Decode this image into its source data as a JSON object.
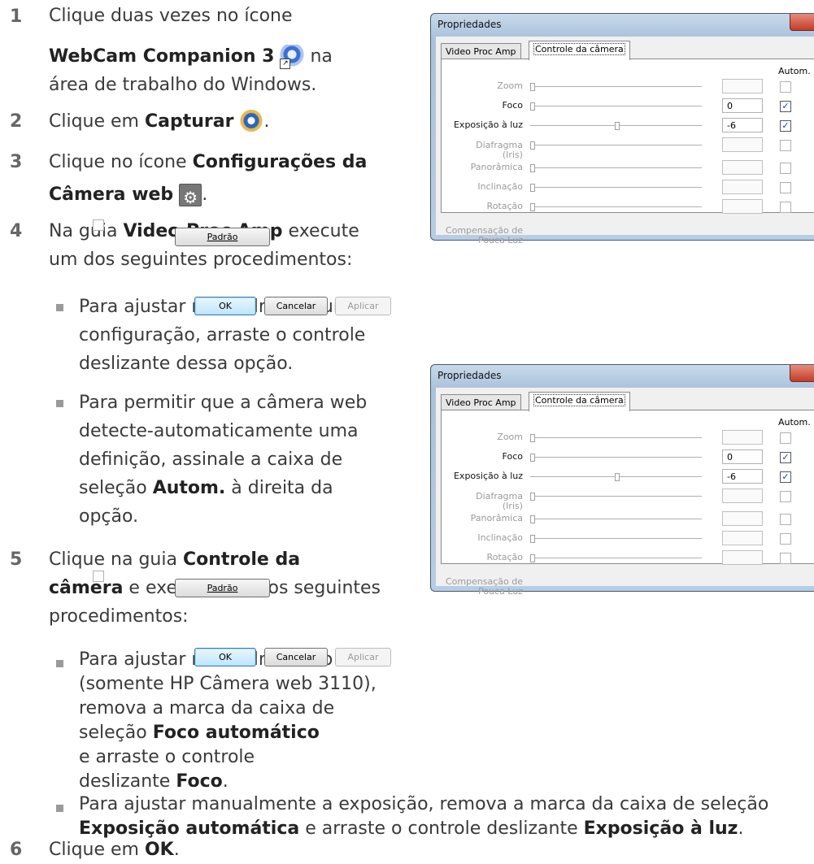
{
  "steps": [
    {
      "num": "1",
      "lines": [
        "Clique duas vezes no ícone"
      ],
      "bold": "WebCam Companion 3",
      "after_icon": "na",
      "line3": "área de trabalho do Windows."
    },
    {
      "num": "2",
      "pre": "Clique em ",
      "bold": "Capturar",
      "post": "."
    },
    {
      "num": "3",
      "pre": "Clique no ícone ",
      "bold1": "Configurações da",
      "bold2": "Câmera web",
      "post": "."
    },
    {
      "num": "4",
      "pre": "Na guia ",
      "bold": "Video Proc Amp",
      "post": " execute",
      "line2": "um dos seguintes procedimentos:"
    },
    {
      "num": "5",
      "pre": "Clique na guia ",
      "bold1": "Controle da",
      "bold2": "câmera",
      "post": " e execute um dos seguintes",
      "line3": "procedimentos:"
    },
    {
      "num": "6",
      "pre": "Clique em ",
      "bold": "OK",
      "post": "."
    }
  ],
  "bullets4": {
    "b1": [
      "Para ajustar manualmente uma",
      "configuração, arraste o controle",
      "deslizante dessa opção."
    ],
    "b2": [
      "Para permitir que a câmera web",
      "detecte-automaticamente uma",
      "definição, assinale a caixa de"
    ],
    "b2_l4_pre": "seleção ",
    "b2_l4_bold": "Autom.",
    "b2_l4_post": " à direita da",
    "b2_l5": "opção."
  },
  "bullets5": {
    "b1": [
      "Para ajustar manualmente o foco",
      "(somente HP Câmera web 3110),",
      "remova a marca da caixa de"
    ],
    "b1_l4_pre": "seleção ",
    "b1_l4_bold": "Foco automático",
    "b1_l5": "e arraste o controle",
    "b1_l6_pre": "deslizante ",
    "b1_l6_bold": "Foco",
    "b1_l6_post": ".",
    "b2_l1": "Para ajustar manualmente a exposição, remova a marca da caixa de seleção",
    "b2_l2_bold1": "Exposição automática",
    "b2_l2_mid": " e arraste o controle deslizante ",
    "b2_l2_bold2": "Exposição à luz",
    "b2_l2_post": "."
  },
  "dialog": {
    "title": "Propriedades",
    "tabs": [
      "Video Proc Amp",
      "Controle da câmera"
    ],
    "autom_label": "Autom.",
    "rows": [
      {
        "label": "Zoom",
        "value": "",
        "enabled": false,
        "checked": false,
        "slider": 0
      },
      {
        "label": "Foco",
        "value": "0",
        "enabled": true,
        "checked": true,
        "slider": 0
      },
      {
        "label": "Exposição à luz",
        "value": "-6",
        "enabled": true,
        "checked": true,
        "slider": 0.5
      },
      {
        "label": "Diafragma",
        "label2": "(Iris)",
        "value": "",
        "enabled": false,
        "checked": false,
        "slider": 0
      },
      {
        "label": "Panorâmica",
        "value": "",
        "enabled": false,
        "checked": false,
        "slider": 0
      },
      {
        "label": "Inclinação",
        "value": "",
        "enabled": false,
        "checked": false,
        "slider": 0
      },
      {
        "label": "Rotação",
        "value": "",
        "enabled": false,
        "checked": false,
        "slider": 0
      }
    ],
    "low_light": [
      "Compensação de",
      "Pouca Luz"
    ],
    "default_button": "Padrão",
    "ok": "OK",
    "cancel": "Cancelar",
    "apply": "Aplicar"
  }
}
